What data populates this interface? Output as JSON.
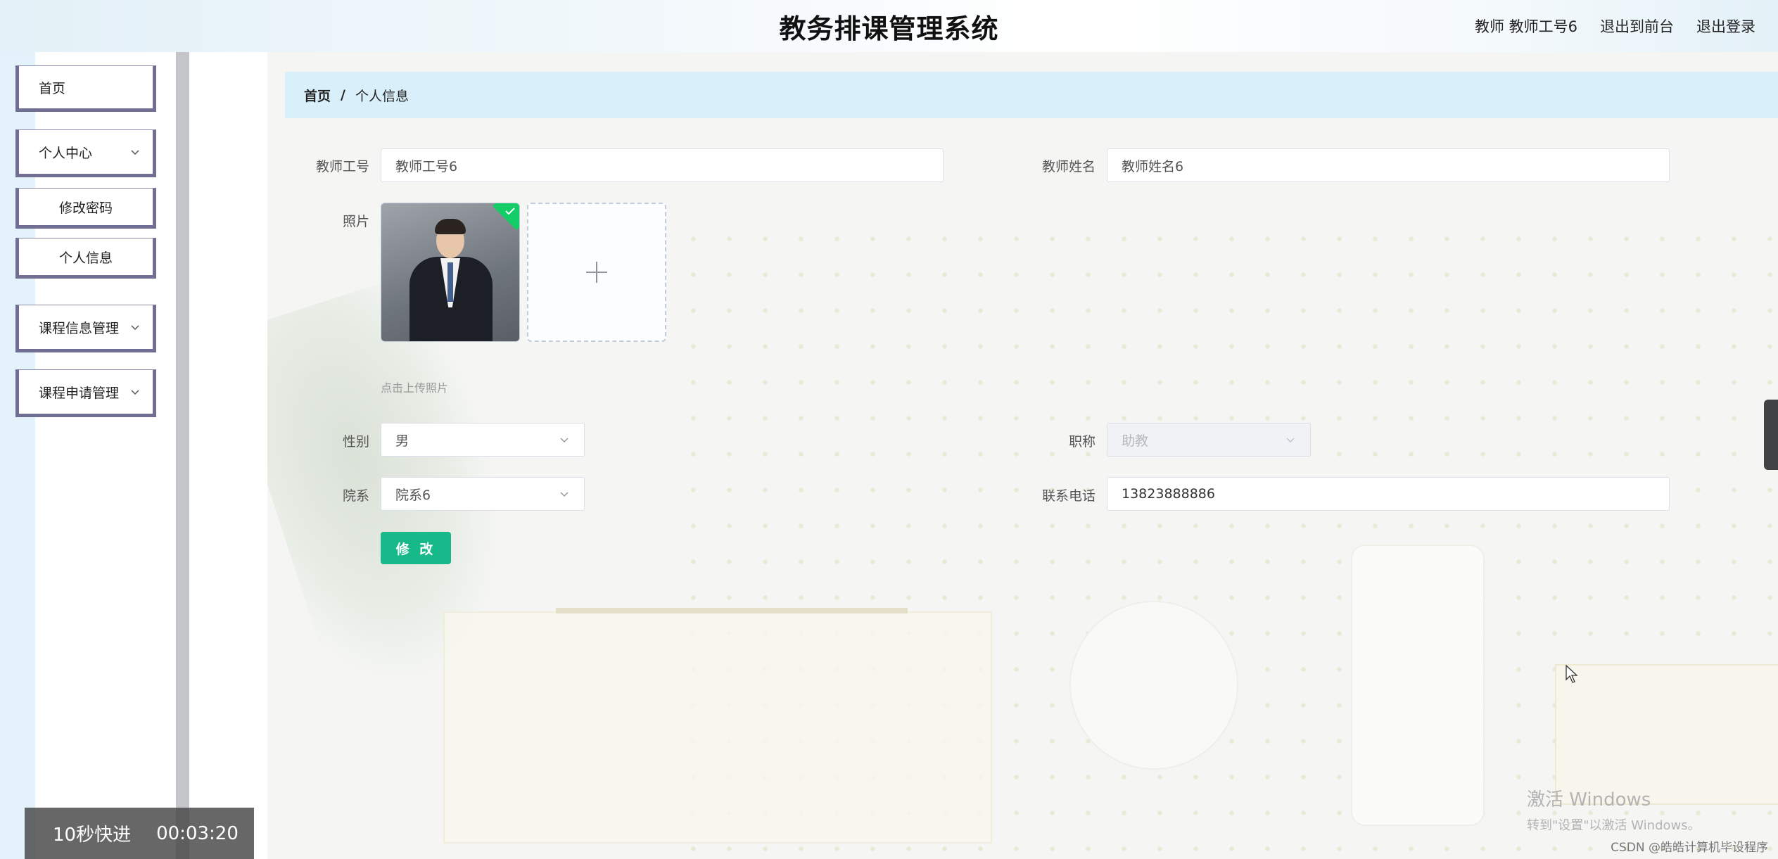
{
  "header": {
    "title": "教务排课管理系统",
    "user": "教师 教师工号6",
    "exit_front": "退出到前台",
    "logout": "退出登录"
  },
  "sidebar": {
    "items": [
      {
        "label": "首页"
      },
      {
        "label": "个人中心",
        "expandable": true
      },
      {
        "label": "修改密码"
      },
      {
        "label": "个人信息"
      },
      {
        "label": "课程信息管理",
        "expandable": true
      },
      {
        "label": "课程申请管理",
        "expandable": true
      }
    ]
  },
  "breadcrumb": {
    "home": "首页",
    "separator": "/",
    "current": "个人信息"
  },
  "form": {
    "teacher_id_label": "教师工号",
    "teacher_id_value": "教师工号6",
    "teacher_name_label": "教师姓名",
    "teacher_name_value": "教师姓名6",
    "photo_label": "照片",
    "upload_hint": "点击上传照片",
    "gender_label": "性别",
    "gender_value": "男",
    "title_label": "职称",
    "title_value": "助教",
    "dept_label": "院系",
    "dept_value": "院系6",
    "phone_label": "联系电话",
    "phone_value": "13823888886",
    "submit_label": "修 改"
  },
  "overlay": {
    "watermark_line1": "激活 Windows",
    "watermark_line2": "转到\"设置\"以激活 Windows。",
    "csdn": "CSDN @皓皓计算机毕设程序",
    "player_skip": "10秒快进",
    "player_time": "00:03:20"
  },
  "colors": {
    "accent": "#17b889",
    "breadcrumb_bg": "#d9f0fb",
    "menu_border": "#706f93",
    "success_badge": "#13ce66"
  }
}
